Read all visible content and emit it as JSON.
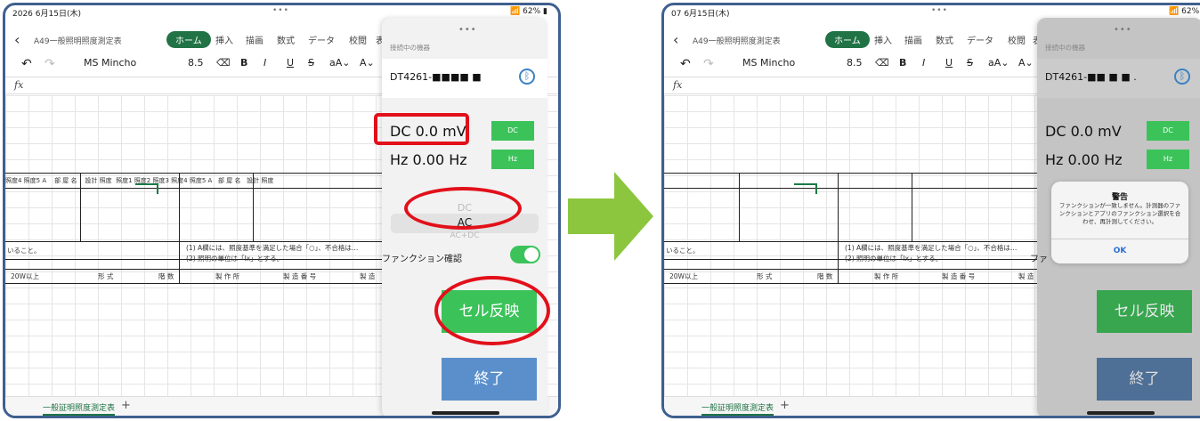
{
  "before": {
    "status_time": "2026 6月15日(木)",
    "status_dots": "•••",
    "status_battery": "📶 62% ▮",
    "doc_name": "A49一般照明照度測定表",
    "tabs": [
      "ホーム",
      "挿入",
      "描画",
      "数式",
      "データ",
      "校閲",
      "表"
    ],
    "font_name": "MS Mincho",
    "font_size": "8.5",
    "fx": "fx",
    "header_cells": [
      "設計 照度 ",
      "照度4 照度5 A",
      "部 屋 名",
      "設計 照度",
      "照度1 照度2 照度3 照度4 照度5 A",
      "部 屋 名",
      "設計 照度 "
    ],
    "note1": "いること。",
    "note2": "(1) A欄には、照度基準を満足した場合「○」、不合格は…",
    "note3": "(2) 照明の単位は「lx」とする。",
    "row_hdr": [
      "20W以上",
      "形 式",
      "階 数",
      "製 作 所",
      "製 造 番 号",
      "製 造"
    ],
    "sheet_tab": "一般証明照度測定表",
    "add_tab": "+",
    "panel": {
      "dots": "•••",
      "connection_label": "接続中の機器",
      "device": "DT4261-■■■■ ■",
      "dc_reading": "DC 0.0 mV",
      "dc_button": "DC",
      "hz_reading": "Hz 0.00 Hz",
      "hz_button": "Hz",
      "picker_above": "DC",
      "picker_selected": "AC",
      "picker_below": "AC+DC",
      "function_check": "ファンクション確認",
      "cell_button": "セル反映",
      "end_button": "終了"
    }
  },
  "after": {
    "status_time": "07 6月15日(木)",
    "status_dots": "•••",
    "status_battery": "📶 62% ▮",
    "doc_name": "A49一般照明照度測定表",
    "tabs": [
      "ホーム",
      "挿入",
      "描画",
      "数式",
      "データ",
      "校閲",
      "表"
    ],
    "font_name": "MS Mincho",
    "font_size": "8.5",
    "fx": "fx",
    "note1": "いること。",
    "note2": "(1) A欄には、照度基準を満足した場合「○」、不合格は…",
    "note3": "(2) 照明の単位は「lx」とする。",
    "row_hdr": [
      "20W以上",
      "形 式",
      "階 数",
      "製 作 所",
      "製 造 番 号",
      "製 造"
    ],
    "sheet_tab": "一般証明照度測定表",
    "add_tab": "+",
    "panel": {
      "dots": "•••",
      "connection_label": "接続中の機器",
      "device": "DT4261-■■ ■ ■ .",
      "dc_reading": "DC 0.0 mV",
      "dc_button": "DC",
      "hz_reading": "Hz 0.00 Hz",
      "hz_button": "Hz",
      "function_check": "ファ",
      "cell_button": "セル反映",
      "end_button": "終了"
    },
    "alert": {
      "title": "警告",
      "message": "ファンクションが一致しません。計測器のファンクションとアプリのファンクション選択を合わせ、再計測してください。",
      "ok": "OK"
    }
  },
  "colors": {
    "accent_green": "#3bc35a",
    "end_blue": "#5b8fcc",
    "highlight_red": "#e2101a",
    "arrow_green": "#8cc63f",
    "frame": "#3f5f8f"
  }
}
